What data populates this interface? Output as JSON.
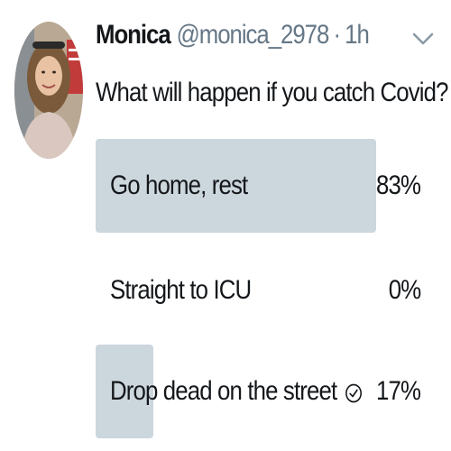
{
  "tweet": {
    "display_name": "Monica",
    "handle": "@monica_2978",
    "separator": "·",
    "time": "1h",
    "question": "What will happen if you catch Covid?"
  },
  "poll": {
    "bar_color": "#ccd6dd",
    "options": [
      {
        "label": "Go home, rest",
        "percent": "83%",
        "share": 0.83,
        "selected": false
      },
      {
        "label": "Straight to ICU",
        "percent": "0%",
        "share": 0.0,
        "selected": false
      },
      {
        "label": "Drop dead on the street",
        "percent": "17%",
        "share": 0.17,
        "selected": true
      }
    ]
  },
  "icons": {
    "menu": "chevron-down-icon",
    "selected": "check-circle-icon"
  }
}
